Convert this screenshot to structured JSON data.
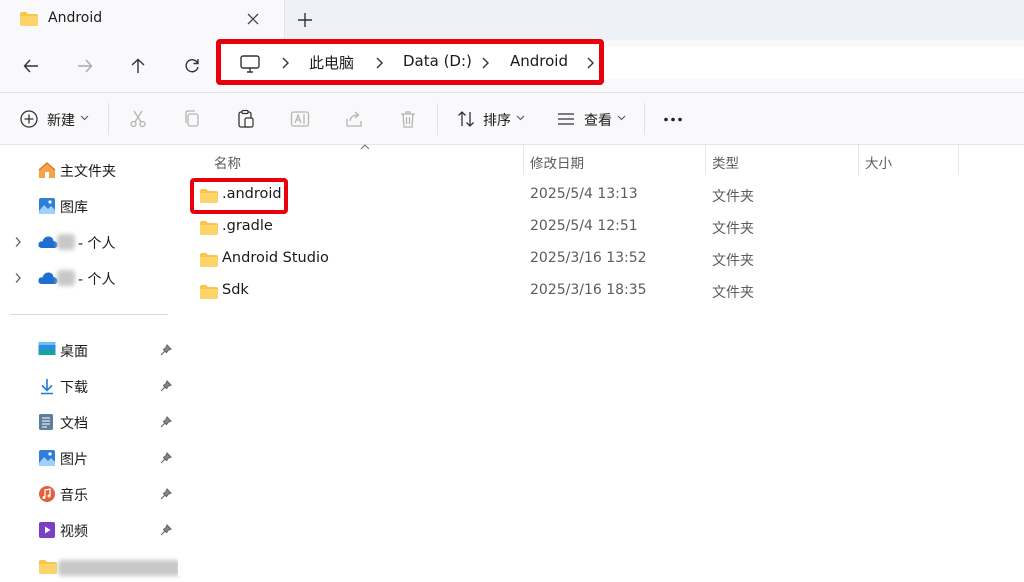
{
  "tab": {
    "title": "Android"
  },
  "address": {
    "crumbs": [
      "此电脑",
      "Data (D:)",
      "Android"
    ]
  },
  "commands": {
    "new_label": "新建",
    "sort_label": "排序",
    "view_label": "查看"
  },
  "sidebar": {
    "home": "主文件夹",
    "gallery": "图库",
    "onedrive1_suffix": "- 个人",
    "onedrive2_suffix": "- 个人",
    "quick": [
      {
        "label": "桌面"
      },
      {
        "label": "下载"
      },
      {
        "label": "文档"
      },
      {
        "label": "图片"
      },
      {
        "label": "音乐"
      },
      {
        "label": "视频"
      }
    ]
  },
  "list": {
    "columns": {
      "name": "名称",
      "modified": "修改日期",
      "type": "类型",
      "size": "大小"
    },
    "rows": [
      {
        "name": ".android",
        "modified": "2025/5/4 13:13",
        "type": "文件夹",
        "size": ""
      },
      {
        "name": ".gradle",
        "modified": "2025/5/4 12:51",
        "type": "文件夹",
        "size": ""
      },
      {
        "name": "Android Studio",
        "modified": "2025/3/16 13:52",
        "type": "文件夹",
        "size": ""
      },
      {
        "name": "Sdk",
        "modified": "2025/3/16 18:35",
        "type": "文件夹",
        "size": ""
      }
    ]
  },
  "colors": {
    "highlight": "#e8000c",
    "folder": "#f8c54a",
    "accent": "#0067c0"
  }
}
